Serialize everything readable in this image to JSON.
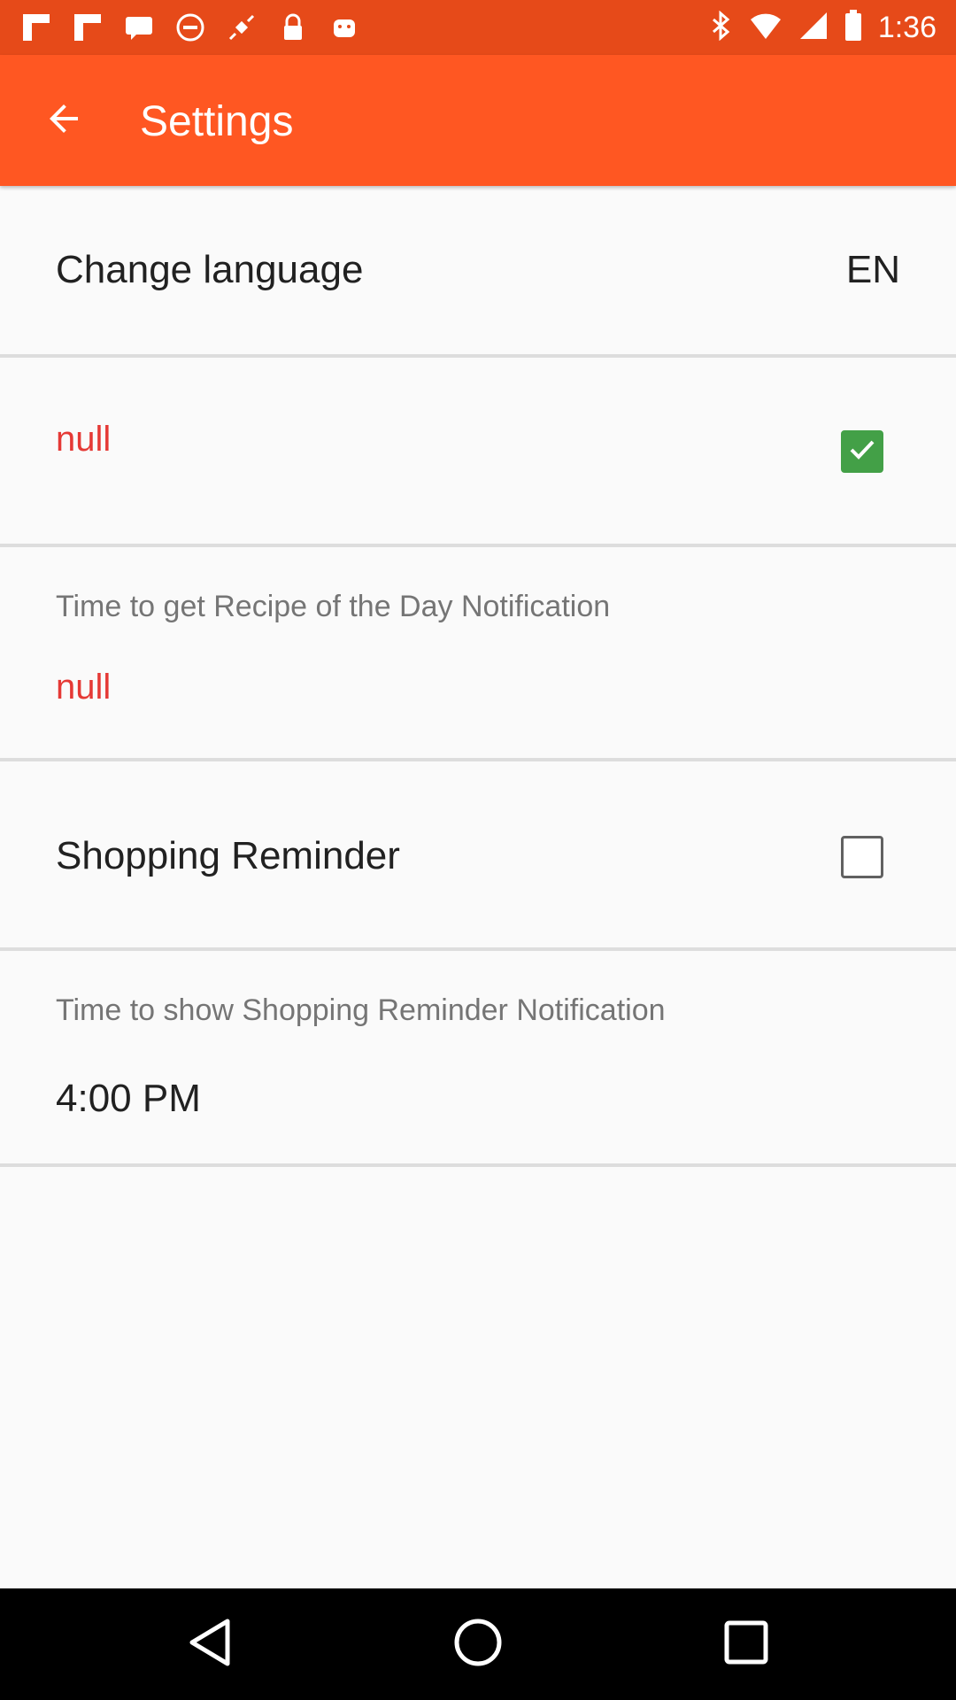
{
  "status_bar": {
    "time": "1:36",
    "left_icons": [
      "flipboard-icon",
      "flipboard-icon",
      "message-icon",
      "no-entry-icon",
      "satellite-icon",
      "lock-icon",
      "android-icon"
    ],
    "right_icons": [
      "bluetooth-icon",
      "wifi-icon",
      "signal-icon",
      "battery-icon"
    ]
  },
  "toolbar": {
    "title": "Settings",
    "back_icon": "arrow-back-icon",
    "color": "#ff5722"
  },
  "prefs": {
    "language": {
      "label": "Change language",
      "value": "EN"
    },
    "recipe_toggle": {
      "label": "null",
      "checked": true
    },
    "recipe_time": {
      "label": "Time to get Recipe of the Day Notification",
      "value": "null"
    },
    "shopping_toggle": {
      "label": "Shopping Reminder",
      "checked": false
    },
    "shopping_time": {
      "label": "Time to show Shopping Reminder Notification",
      "value": "4:00 PM"
    }
  },
  "colors": {
    "accent": "#43a047",
    "status_bar": "#e64a19",
    "warning_text": "#e53935"
  },
  "nav_bar": {
    "icons": [
      "back-nav-icon",
      "home-nav-icon",
      "recents-nav-icon"
    ]
  }
}
